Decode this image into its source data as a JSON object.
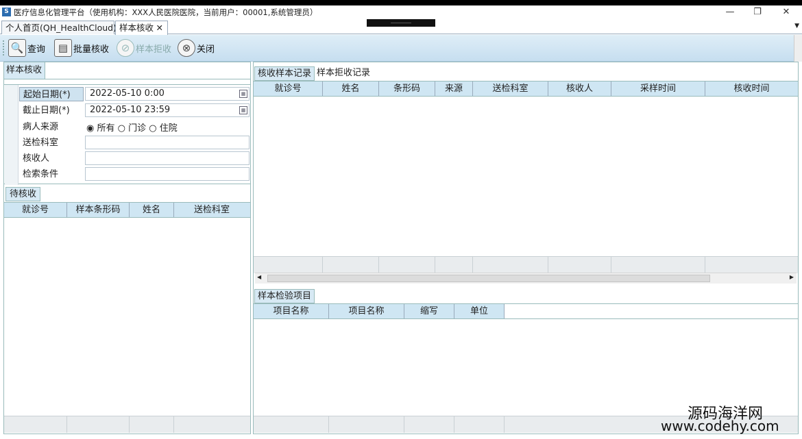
{
  "window": {
    "title": "医疗信息化管理平台（使用机构：XXX人民医院医院，当前用户：00001,系统管理员）",
    "app_icon": "app-logo-icon",
    "minimize": "—",
    "restore": "❐",
    "close": "✕"
  },
  "tabs": [
    {
      "label": "个人首页(QH_HealthCloud)"
    },
    {
      "label": "样本核收",
      "close": "✕"
    }
  ],
  "toolbar": {
    "query": "查询",
    "batch_verify": "批量核收",
    "reject": "样本拒收",
    "close": "关闭"
  },
  "left": {
    "section_title": "样本核收",
    "form": {
      "start_label": "起始日期(*)",
      "start_value": "2022-05-10 0:00",
      "end_label": "截止日期(*)",
      "end_value": "2022-05-10 23:59",
      "source_label": "病人来源",
      "source_options": [
        "所有",
        "门诊",
        "住院"
      ],
      "dept_label": "送检科室",
      "receiver_label": "核收人",
      "search_label": "检索条件"
    },
    "pending_tab": "待核收",
    "pending_columns": [
      "就诊号",
      "样本条形码",
      "姓名",
      "送检科室"
    ]
  },
  "right": {
    "tabs": [
      "核收样本记录",
      "样本拒收记录"
    ],
    "record_columns": [
      "就诊号",
      "姓名",
      "条形码",
      "来源",
      "送检科室",
      "核收人",
      "采样时间",
      "核收时间"
    ],
    "items_tab": "样本检验项目",
    "item_columns": [
      "项目名称",
      "项目名称",
      "缩写",
      "单位"
    ]
  },
  "watermark": {
    "line1": "源码海洋网",
    "line2": "www.codehy.com"
  },
  "colors": {
    "header_bg": "#cfe6f3",
    "toolbar_bg": "#c6def0",
    "border": "#9bb"
  }
}
